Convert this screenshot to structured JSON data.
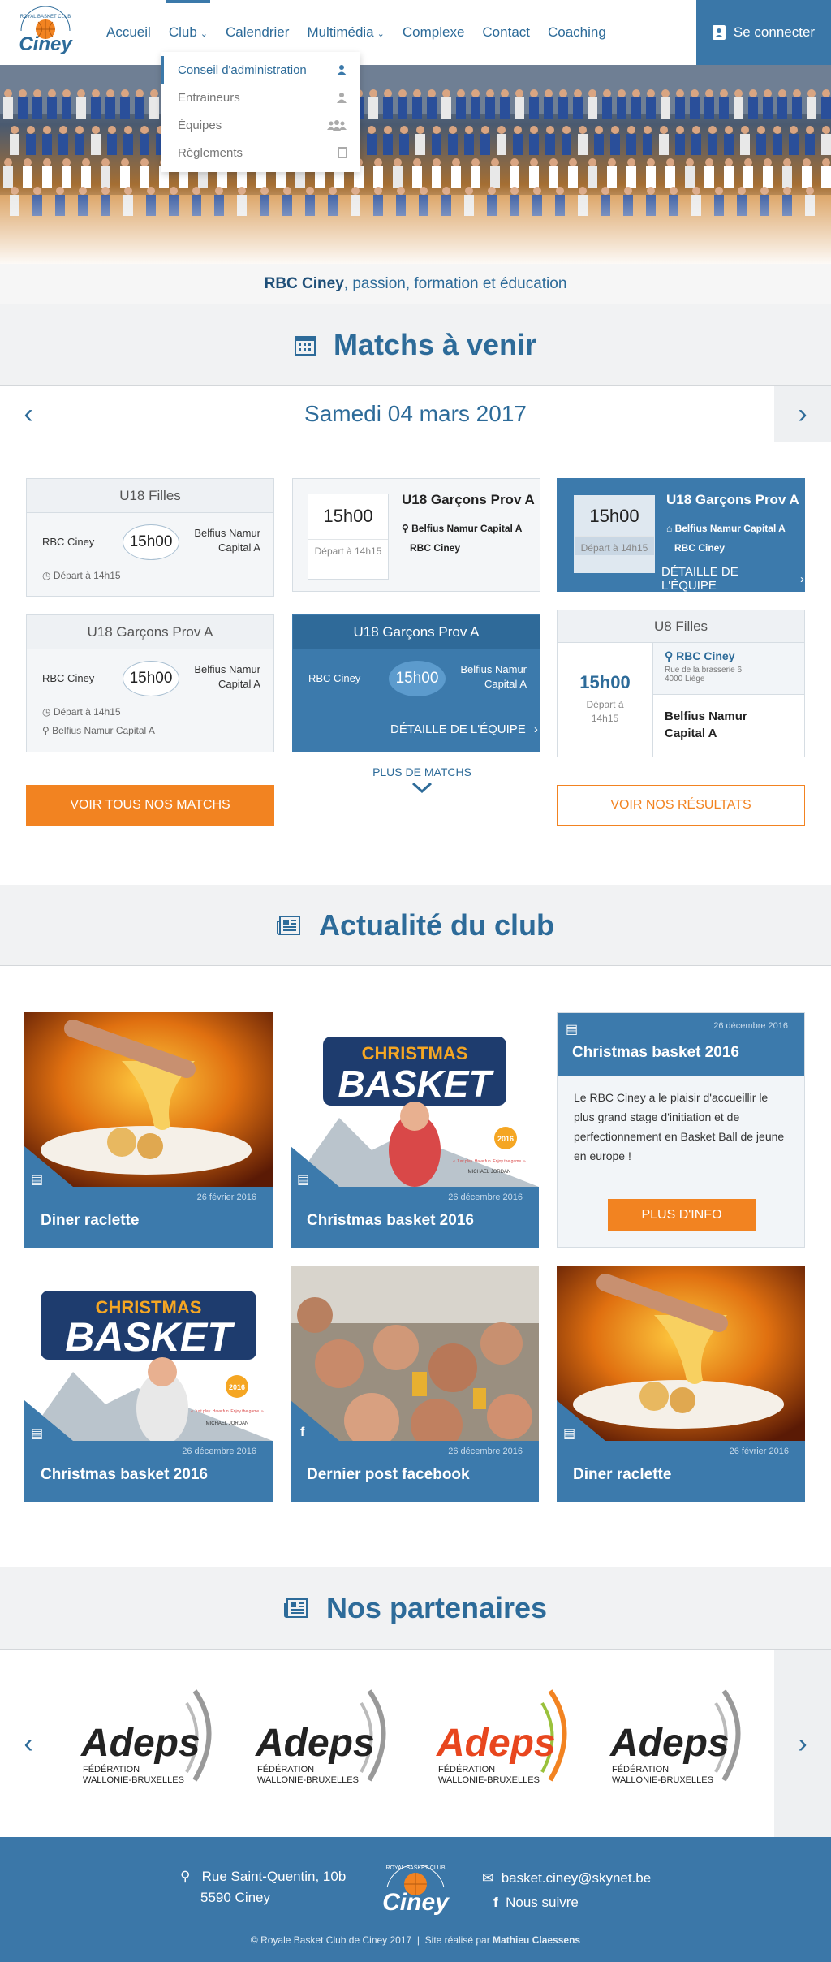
{
  "header": {
    "nav": [
      "Accueil",
      "Club",
      "Calendrier",
      "Multimédia",
      "Complexe",
      "Contact",
      "Coaching"
    ],
    "login_label": "Se connecter"
  },
  "logo": {
    "top_text": "ROYAL BASKET CLUB",
    "name": "Ciney"
  },
  "club_dropdown": [
    "Conseil d'administration",
    "Entraineurs",
    "Équipes",
    "Règlements"
  ],
  "hero": {
    "tagline_bold": "RBC Ciney",
    "tagline_rest": ", passion, formation et éducation"
  },
  "matchs": {
    "heading": "Matchs à venir",
    "date": "Samedi 04 mars 2017",
    "cards": [
      {
        "title": "U18 Filles",
        "home": "RBC Ciney",
        "score": "15h00",
        "away": "Belfius Namur Capital A",
        "depart": "Départ à 14h15"
      },
      {
        "title": "U18 Garçons Prov A",
        "time": "15h00",
        "depart": "Départ à 14h15",
        "location": "Belfius Namur Capital A",
        "home": "RBC Ciney"
      },
      {
        "title": "U18 Garçons Prov A",
        "time": "15h00",
        "depart": "Départ à 14h15",
        "location": "Belfius Namur Capital A",
        "home": "RBC Ciney",
        "detail": "DÉTAILLE DE L'ÉQUIPE"
      },
      {
        "title": "U18 Garçons Prov A",
        "home": "RBC Ciney",
        "score": "15h00",
        "away": "Belfius Namur Capital A",
        "depart": "Départ à 14h15",
        "location": "Belfius Namur Capital A"
      },
      {
        "title": "U18 Garçons Prov A",
        "home": "RBC Ciney",
        "score": "15h00",
        "away": "Belfius Namur Capital A",
        "detail": "DÉTAILLE DE L'ÉQUIPE"
      },
      {
        "title": "U8 Filles",
        "time": "15h00",
        "depart": "Départ à 14h15",
        "location": "RBC Ciney",
        "address1": "Rue de la brasserie 6",
        "address2": "4000 Liège",
        "away": "Belfius Namur Capital A"
      }
    ],
    "btn_all": "VOIR TOUS NOS MATCHS",
    "more": "PLUS DE MATCHS",
    "btn_results": "VOIR NOS RÉSULTATS"
  },
  "news": {
    "heading": "Actualité du club",
    "items": [
      {
        "title": "Diner raclette",
        "date": "26 février 2016",
        "badge": "news-icon"
      },
      {
        "title": "Christmas basket 2016",
        "date": "26 décembre 2016",
        "badge": "news-icon"
      },
      {
        "title": "Christmas basket 2016",
        "date": "26 décembre 2016",
        "badge": "news-icon"
      },
      {
        "title": "Dernier post facebook",
        "date": "26 décembre 2016",
        "badge": "facebook-icon"
      },
      {
        "title": "Diner raclette",
        "date": "26 février 2016",
        "badge": "news-icon"
      }
    ],
    "featured": {
      "date": "26 décembre 2016",
      "title": "Christmas basket 2016",
      "text": "Le RBC Ciney a le plaisir d'accueillir le plus grand stage d'initiation et de perfectionnement en Basket Ball de jeune en europe !",
      "btn": "PLUS D'INFO"
    },
    "christmas": {
      "line1": "CHRISTMAS",
      "line2": "BASKET",
      "year": "2016",
      "sub": "« Just play. Have fun. Enjoy the game. »",
      "sign": "MICHAEL JORDAN"
    }
  },
  "partners": {
    "heading": "Nos partenaires",
    "logo_text": "Adeps",
    "logo_sub1": "FÉDÉRATION",
    "logo_sub2": "WALLONIE-BRUXELLES"
  },
  "footer": {
    "address1": "Rue Saint-Quentin, 10b",
    "address2": "5590 Ciney",
    "email": "basket.ciney@skynet.be",
    "follow": "Nous suivre",
    "copyright": "© Royale Basket Club de Ciney 2017  |  Site réalisé par ",
    "author": "Mathieu Claessens"
  },
  "colors": {
    "primary": "#3c7aac",
    "accent": "#f28321",
    "title": "#2d6b99"
  }
}
